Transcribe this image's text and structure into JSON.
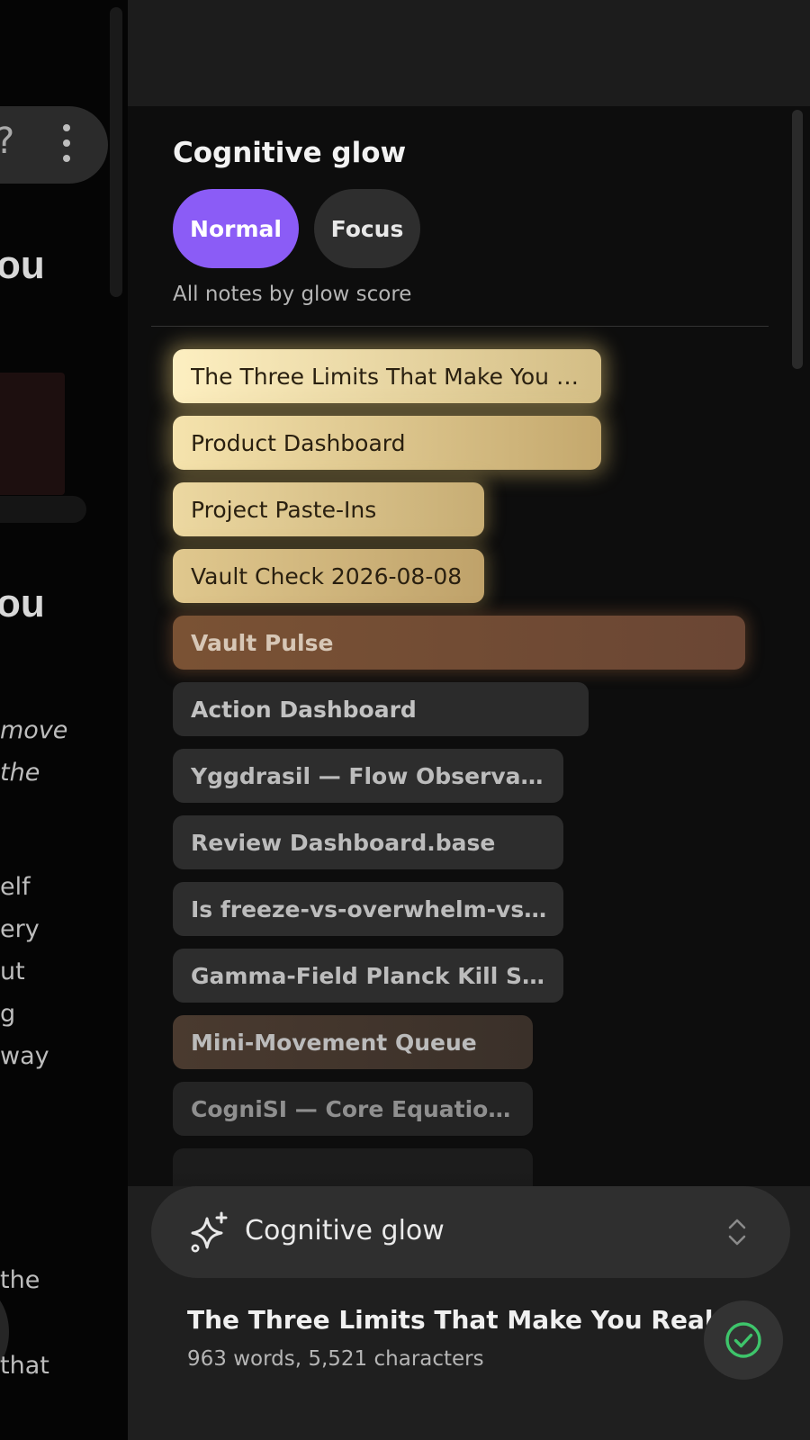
{
  "background_editor": {
    "headings": [
      "ou",
      "ou"
    ],
    "text_lines": [
      {
        "text": "move",
        "italic": true
      },
      {
        "text": " the",
        "italic": true
      },
      {
        "text": "elf",
        "italic": false
      },
      {
        "text": "ery",
        "italic": false
      },
      {
        "text": "ut",
        "italic": false
      },
      {
        "text": "g",
        "italic": false
      },
      {
        "text": " way",
        "italic": false
      },
      {
        "text": "the",
        "italic": false
      },
      {
        "text": " that",
        "italic": false
      }
    ]
  },
  "panel": {
    "title": "Cognitive glow",
    "modes": {
      "normal": "Normal",
      "focus": "Focus"
    },
    "subtitle": "All notes by glow score",
    "notes": [
      {
        "title": "The Three Limits That Make You Real",
        "display": "The Three Limits That Make You R..."
      },
      {
        "title": "Product Dashboard",
        "display": "Product Dashboard"
      },
      {
        "title": "Project Paste-Ins",
        "display": "Project Paste-Ins"
      },
      {
        "title": "Vault Check 2026-08-08",
        "display": "Vault Check 2026-08-08"
      },
      {
        "title": "Vault Pulse",
        "display": "Vault Pulse"
      },
      {
        "title": "Action Dashboard",
        "display": "Action Dashboard"
      },
      {
        "title": "Yggdrasil — Flow Observatory",
        "display": "Yggdrasil — Flow Observatory"
      },
      {
        "title": "Review Dashboard.base",
        "display": "Review Dashboard.base"
      },
      {
        "title": "Is freeze-vs-overwhelm-vs-stu...",
        "display": "Is freeze-vs-overwhelm-vs-stu..."
      },
      {
        "title": "Gamma-Field Planck Kill Shot ...",
        "display": "Gamma-Field Planck Kill Shot ..."
      },
      {
        "title": "Mini-Movement Queue",
        "display": "Mini-Movement Queue"
      },
      {
        "title": "CogniSI — Core Equations ...",
        "display": "CogniSI — Core Equations ..."
      }
    ]
  },
  "view_selector": {
    "icon": "sparkle-icon",
    "label": "Cognitive glow",
    "chevron_icon": "chevron-up-down-icon"
  },
  "status": {
    "doc_title": "The Three Limits That Make You Real",
    "stats": "963 words, 5,521 characters",
    "sync_icon": "check-circle-icon"
  },
  "colors": {
    "accent": "#8b5cf6",
    "glow_gold": "#f5e3ad",
    "glow_warm": "#7a5234",
    "check_green": "#3ec56b"
  }
}
